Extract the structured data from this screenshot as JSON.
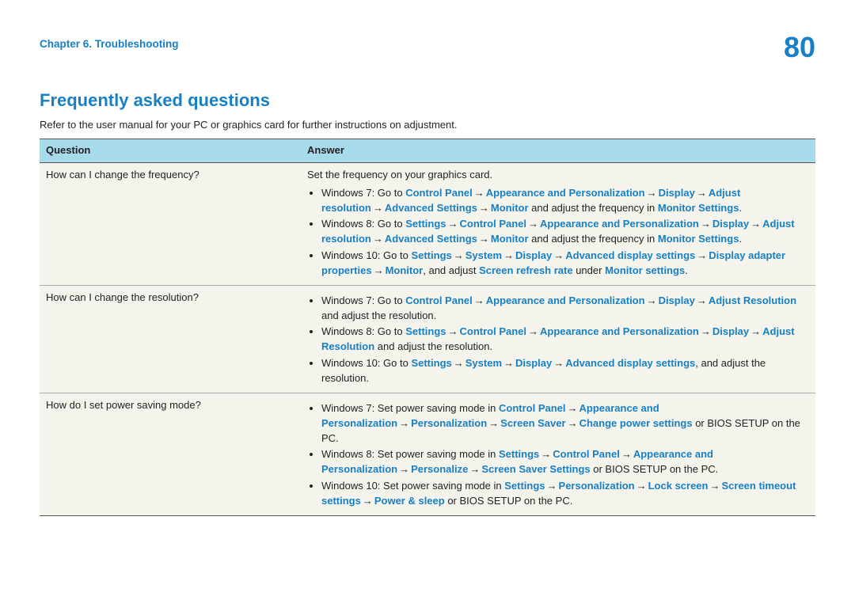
{
  "header": {
    "chapter": "Chapter 6. Troubleshooting",
    "page_number": "80"
  },
  "section": {
    "title": "Frequently asked questions",
    "intro": "Refer to the user manual for your PC or graphics card for further instructions on adjustment."
  },
  "table": {
    "headers": {
      "question": "Question",
      "answer": "Answer"
    },
    "rows": [
      {
        "question": "How can I change the frequency?",
        "lead": "Set the frequency on your graphics card.",
        "items": [
          {
            "segments": [
              {
                "t": "Windows 7: Go to ",
                "b": false
              },
              {
                "t": "Control Panel",
                "b": true
              },
              {
                "t": " → ",
                "a": true
              },
              {
                "t": "Appearance and Personalization",
                "b": true
              },
              {
                "t": " → ",
                "a": true
              },
              {
                "t": "Display",
                "b": true
              },
              {
                "t": " → ",
                "a": true
              },
              {
                "t": "Adjust resolution",
                "b": true
              },
              {
                "t": " → ",
                "a": true
              },
              {
                "t": "Advanced Settings",
                "b": true
              },
              {
                "t": " → ",
                "a": true
              },
              {
                "t": "Monitor",
                "b": true
              },
              {
                "t": " and adjust the frequency in ",
                "b": false
              },
              {
                "t": "Monitor Settings",
                "b": true
              },
              {
                "t": ".",
                "b": false
              }
            ]
          },
          {
            "segments": [
              {
                "t": "Windows 8: Go to ",
                "b": false
              },
              {
                "t": "Settings",
                "b": true
              },
              {
                "t": " → ",
                "a": true
              },
              {
                "t": "Control Panel",
                "b": true
              },
              {
                "t": " → ",
                "a": true
              },
              {
                "t": "Appearance and Personalization",
                "b": true
              },
              {
                "t": " → ",
                "a": true
              },
              {
                "t": "Display",
                "b": true
              },
              {
                "t": " → ",
                "a": true
              },
              {
                "t": "Adjust resolution",
                "b": true
              },
              {
                "t": " → ",
                "a": true
              },
              {
                "t": "Advanced Settings",
                "b": true
              },
              {
                "t": " → ",
                "a": true
              },
              {
                "t": "Monitor",
                "b": true
              },
              {
                "t": " and adjust the frequency in ",
                "b": false
              },
              {
                "t": "Monitor Settings",
                "b": true
              },
              {
                "t": ".",
                "b": false
              }
            ]
          },
          {
            "segments": [
              {
                "t": "Windows 10: Go to ",
                "b": false
              },
              {
                "t": "Settings",
                "b": true
              },
              {
                "t": " → ",
                "a": true
              },
              {
                "t": "System",
                "b": true
              },
              {
                "t": " → ",
                "a": true
              },
              {
                "t": "Display",
                "b": true
              },
              {
                "t": " → ",
                "a": true
              },
              {
                "t": "Advanced display settings",
                "b": true
              },
              {
                "t": " → ",
                "a": true
              },
              {
                "t": "Display adapter properties",
                "b": true
              },
              {
                "t": " → ",
                "a": true
              },
              {
                "t": "Monitor",
                "b": true
              },
              {
                "t": ", and adjust ",
                "b": false
              },
              {
                "t": "Screen refresh rate",
                "b": true
              },
              {
                "t": " under ",
                "b": false
              },
              {
                "t": "Monitor settings",
                "b": true
              },
              {
                "t": ".",
                "b": false
              }
            ]
          }
        ]
      },
      {
        "question": "How can I change the resolution?",
        "lead": "",
        "items": [
          {
            "segments": [
              {
                "t": "Windows 7: Go to ",
                "b": false
              },
              {
                "t": "Control Panel",
                "b": true
              },
              {
                "t": " → ",
                "a": true
              },
              {
                "t": "Appearance and Personalization",
                "b": true
              },
              {
                "t": " → ",
                "a": true
              },
              {
                "t": "Display",
                "b": true
              },
              {
                "t": " → ",
                "a": true
              },
              {
                "t": "Adjust Resolution",
                "b": true
              },
              {
                "t": " and adjust the resolution.",
                "b": false
              }
            ]
          },
          {
            "segments": [
              {
                "t": "Windows 8: Go to ",
                "b": false
              },
              {
                "t": "Settings",
                "b": true
              },
              {
                "t": " → ",
                "a": true
              },
              {
                "t": "Control Panel",
                "b": true
              },
              {
                "t": " → ",
                "a": true
              },
              {
                "t": "Appearance and Personalization",
                "b": true
              },
              {
                "t": " → ",
                "a": true
              },
              {
                "t": "Display",
                "b": true
              },
              {
                "t": " → ",
                "a": true
              },
              {
                "t": "Adjust Resolution",
                "b": true
              },
              {
                "t": " and adjust the resolution.",
                "b": false
              }
            ]
          },
          {
            "segments": [
              {
                "t": "Windows 10: Go to ",
                "b": false
              },
              {
                "t": "Settings",
                "b": true
              },
              {
                "t": " → ",
                "a": true
              },
              {
                "t": "System",
                "b": true
              },
              {
                "t": " → ",
                "a": true
              },
              {
                "t": "Display",
                "b": true
              },
              {
                "t": " → ",
                "a": true
              },
              {
                "t": "Advanced display settings",
                "b": true
              },
              {
                "t": ", and adjust the resolution.",
                "b": false
              }
            ]
          }
        ]
      },
      {
        "question": "How do I set power saving mode?",
        "lead": "",
        "items": [
          {
            "segments": [
              {
                "t": "Windows 7: Set power saving mode in ",
                "b": false
              },
              {
                "t": "Control Panel",
                "b": true
              },
              {
                "t": " → ",
                "a": true
              },
              {
                "t": "Appearance and Personalization",
                "b": true
              },
              {
                "t": " → ",
                "a": true
              },
              {
                "t": "Personalization",
                "b": true
              },
              {
                "t": " → ",
                "a": true
              },
              {
                "t": "Screen Saver",
                "b": true
              },
              {
                "t": " → ",
                "a": true
              },
              {
                "t": "Change power settings",
                "b": true
              },
              {
                "t": " or BIOS SETUP on the PC.",
                "b": false
              }
            ]
          },
          {
            "segments": [
              {
                "t": "Windows 8: Set power saving mode in ",
                "b": false
              },
              {
                "t": "Settings",
                "b": true
              },
              {
                "t": " → ",
                "a": true
              },
              {
                "t": "Control Panel",
                "b": true
              },
              {
                "t": " → ",
                "a": true
              },
              {
                "t": "Appearance and Personalization",
                "b": true
              },
              {
                "t": " → ",
                "a": true
              },
              {
                "t": "Personalize",
                "b": true
              },
              {
                "t": " → ",
                "a": true
              },
              {
                "t": "Screen Saver Settings",
                "b": true
              },
              {
                "t": " or BIOS SETUP on the PC.",
                "b": false
              }
            ]
          },
          {
            "segments": [
              {
                "t": "Windows 10: Set power saving mode in ",
                "b": false
              },
              {
                "t": "Settings",
                "b": true
              },
              {
                "t": " → ",
                "a": true
              },
              {
                "t": "Personalization",
                "b": true
              },
              {
                "t": " → ",
                "a": true
              },
              {
                "t": "Lock screen",
                "b": true
              },
              {
                "t": " → ",
                "a": true
              },
              {
                "t": "Screen timeout settings",
                "b": true
              },
              {
                "t": " → ",
                "a": true
              },
              {
                "t": "Power & sleep",
                "b": true
              },
              {
                "t": " or BIOS SETUP on the PC.",
                "b": false
              }
            ]
          }
        ]
      }
    ]
  }
}
